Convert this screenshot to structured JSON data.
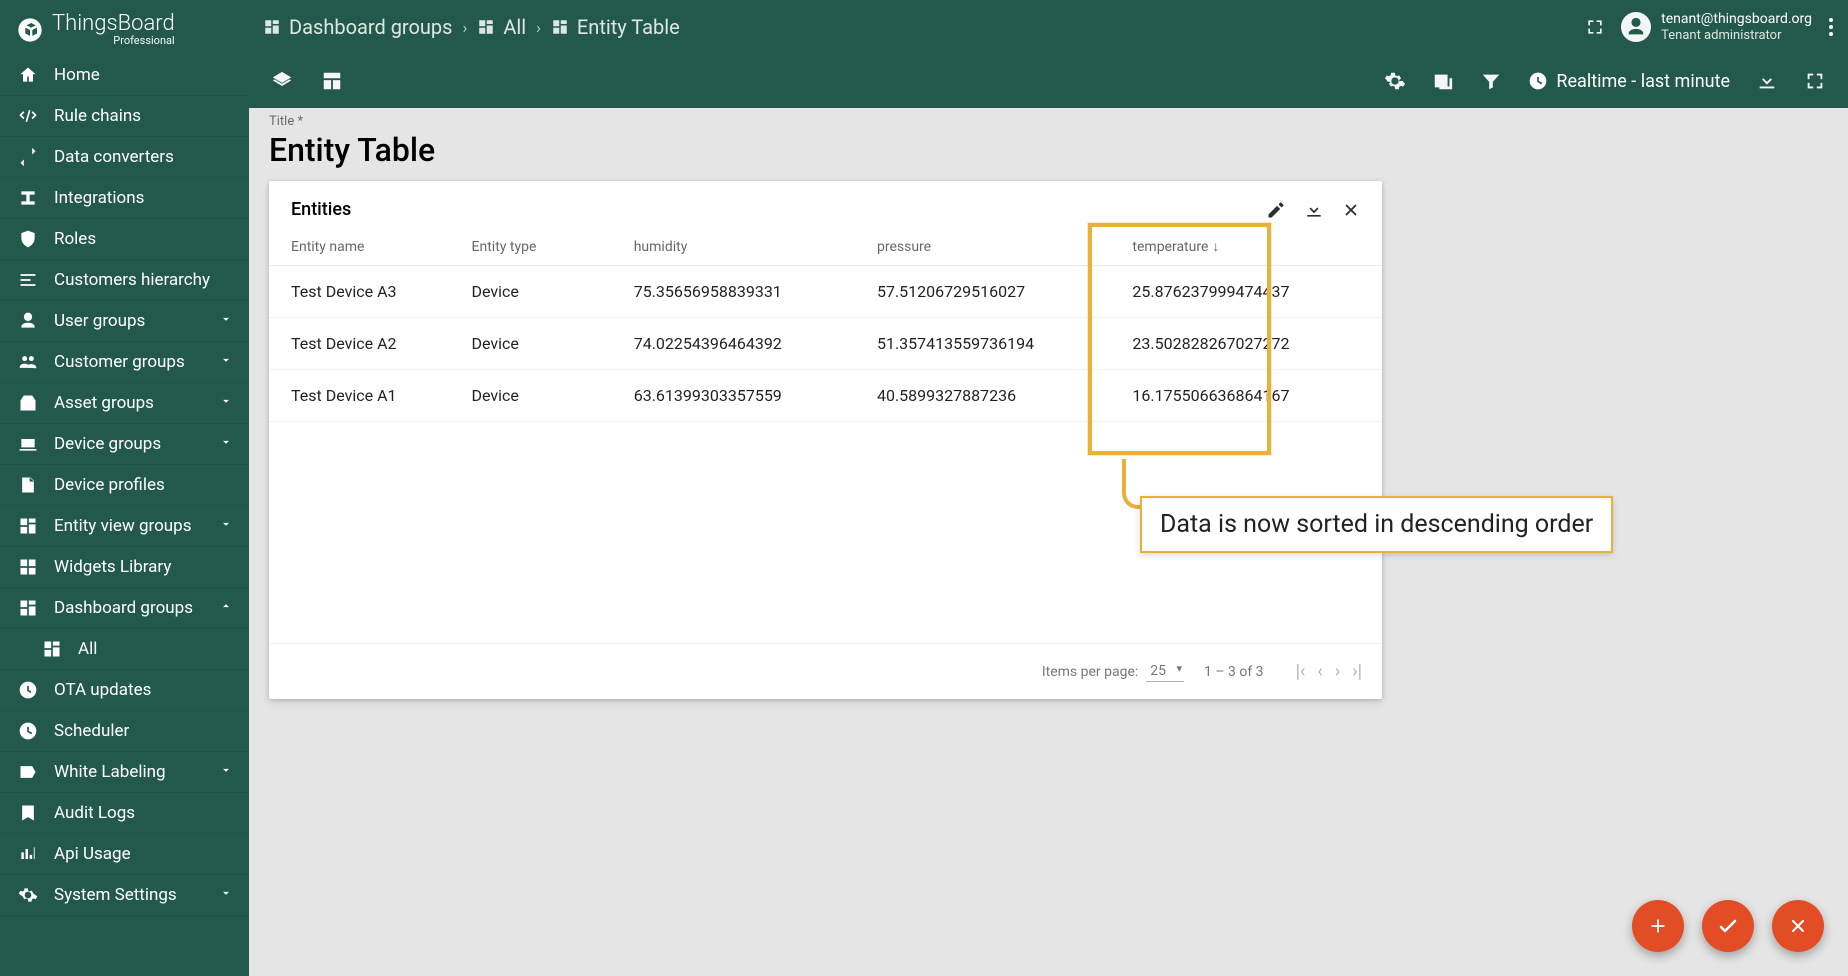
{
  "brand": {
    "name": "ThingsBoard",
    "edition": "Professional"
  },
  "sidebar": {
    "items": [
      {
        "label": "Home",
        "icon": "home"
      },
      {
        "label": "Rule chains",
        "icon": "rule"
      },
      {
        "label": "Data converters",
        "icon": "convert"
      },
      {
        "label": "Integrations",
        "icon": "integration"
      },
      {
        "label": "Roles",
        "icon": "shield"
      },
      {
        "label": "Customers hierarchy",
        "icon": "hierarchy"
      },
      {
        "label": "User groups",
        "icon": "user",
        "expand": true
      },
      {
        "label": "Customer groups",
        "icon": "customers",
        "expand": true
      },
      {
        "label": "Asset groups",
        "icon": "asset",
        "expand": true
      },
      {
        "label": "Device groups",
        "icon": "device",
        "expand": true
      },
      {
        "label": "Device profiles",
        "icon": "profile"
      },
      {
        "label": "Entity view groups",
        "icon": "entityview",
        "expand": true
      },
      {
        "label": "Widgets Library",
        "icon": "widgets"
      },
      {
        "label": "Dashboard groups",
        "icon": "dashboard",
        "expand": "up"
      },
      {
        "label": "All",
        "icon": "dashboard",
        "sub": true
      },
      {
        "label": "OTA updates",
        "icon": "ota"
      },
      {
        "label": "Scheduler",
        "icon": "clock"
      },
      {
        "label": "White Labeling",
        "icon": "label",
        "expand": true
      },
      {
        "label": "Audit Logs",
        "icon": "audit"
      },
      {
        "label": "Api Usage",
        "icon": "api"
      },
      {
        "label": "System Settings",
        "icon": "settings",
        "expand": true
      }
    ]
  },
  "breadcrumbs": {
    "a": "Dashboard groups",
    "b": "All",
    "c": "Entity Table"
  },
  "user": {
    "email": "tenant@thingsboard.org",
    "role": "Tenant administrator"
  },
  "toolbar": {
    "realtime": "Realtime - last minute"
  },
  "page": {
    "title_label": "Title *",
    "title": "Entity Table"
  },
  "widget": {
    "title": "Entities",
    "columns": {
      "name": "Entity name",
      "type": "Entity type",
      "humidity": "humidity",
      "pressure": "pressure",
      "temperature": "temperature"
    },
    "rows": [
      {
        "name": "Test Device A3",
        "type": "Device",
        "humidity": "75.35656958839331",
        "pressure": "57.51206729516027",
        "temperature": "25.876237999474437"
      },
      {
        "name": "Test Device A2",
        "type": "Device",
        "humidity": "74.02254396464392",
        "pressure": "51.357413559736194",
        "temperature": "23.502828267027272"
      },
      {
        "name": "Test Device A1",
        "type": "Device",
        "humidity": "63.61399303357559",
        "pressure": "40.5899327887236",
        "temperature": "16.175506636864167"
      }
    ],
    "pager": {
      "label": "Items per page:",
      "per_page": "25",
      "range": "1 – 3 of 3"
    }
  },
  "annotation": {
    "text": "Data is now sorted in descending order"
  }
}
